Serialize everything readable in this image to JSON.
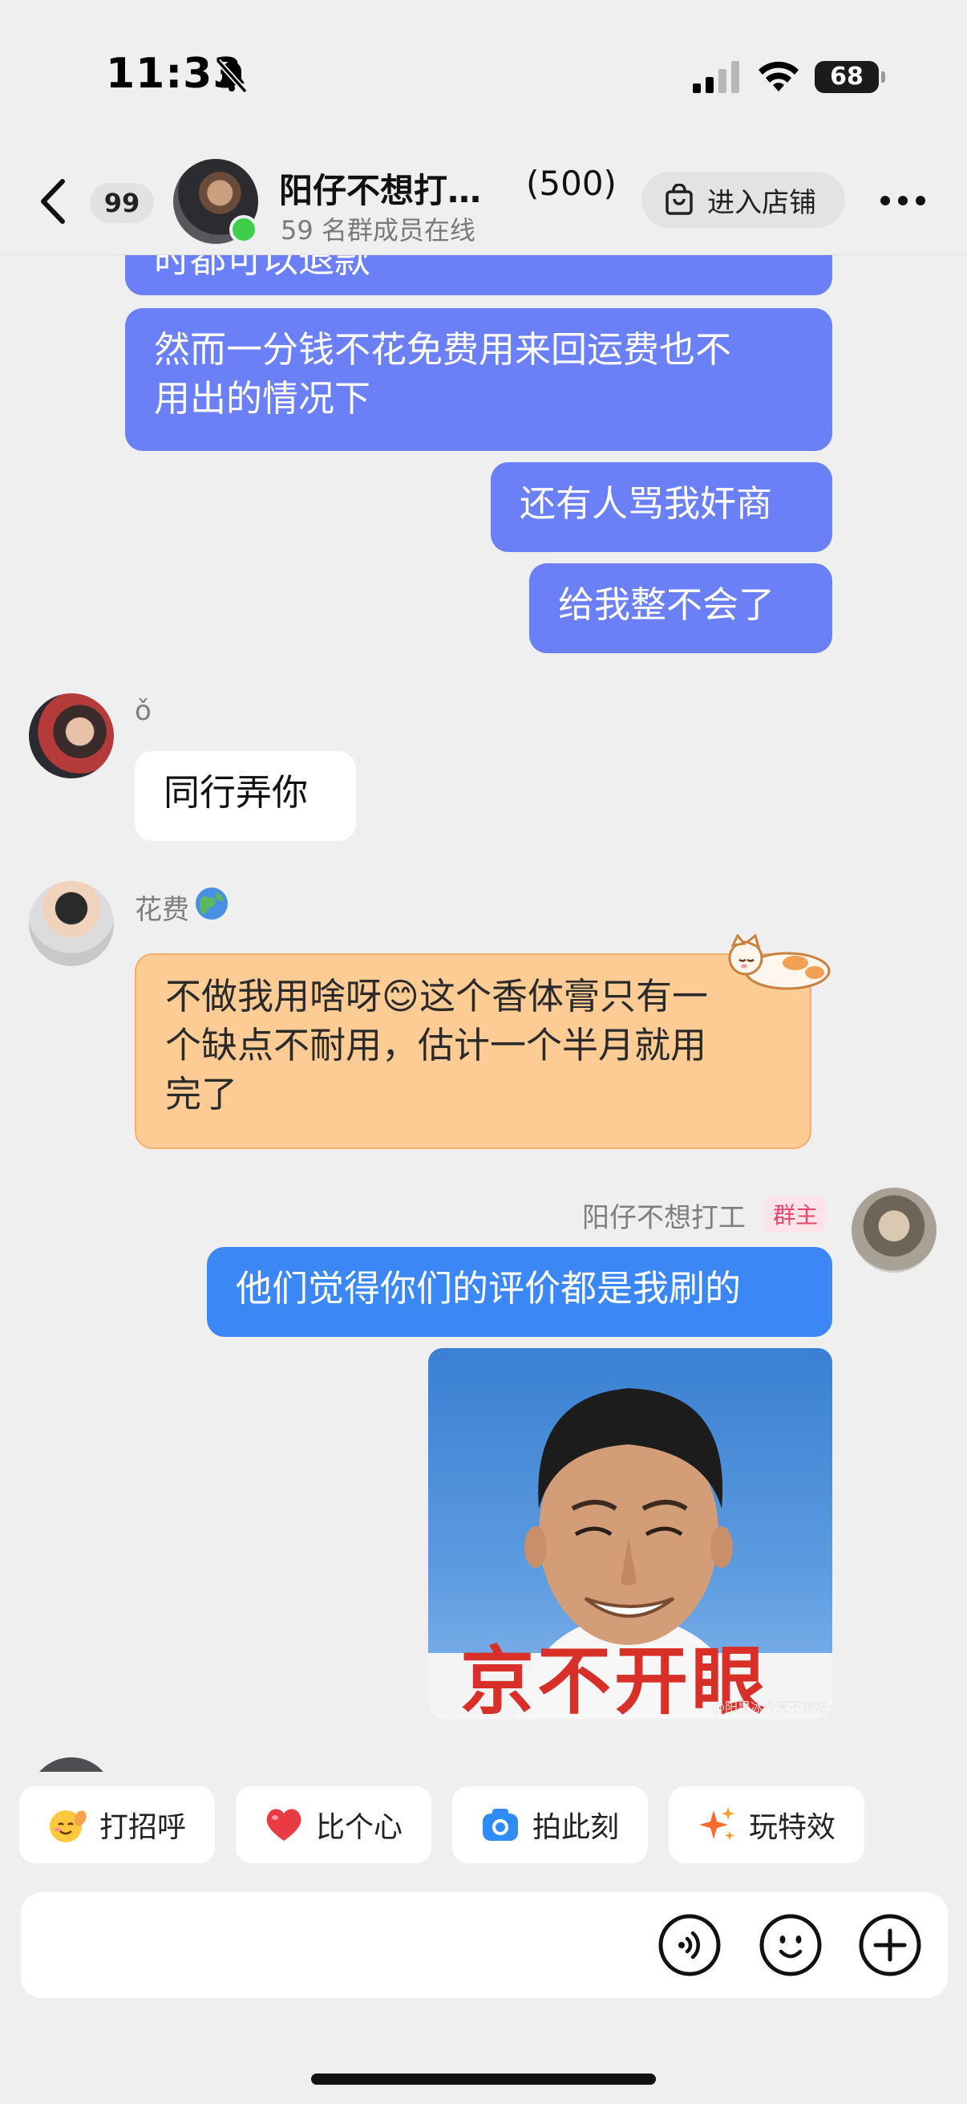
{
  "status_bar": {
    "time": "11:33",
    "battery": "68"
  },
  "header": {
    "unread_count": "99",
    "group_name": "阳仔不想打…",
    "member_count": "(500)",
    "online_text": "59 名群成员在线",
    "shop_button_label": "进入店铺"
  },
  "messages": {
    "m0_partial": "时都可以退款",
    "m1": "然而一分钱不花免费用来回运费也不\n用出的情况下",
    "m2": "还有人骂我奸商",
    "m3": "给我整不会了",
    "m4_sender": "ǒ",
    "m4": "同行弄你",
    "m5_sender": "花费",
    "m5_text": "不做我用啥呀",
    "m5_emoji": "😊",
    "m5_rest": "这个香体膏只有一\n个缺点不耐用，估计一个半月就用\n完了",
    "m6_sender": "阳仔不想打工",
    "m6_role": "群主",
    "m6": "他们觉得你们的评价都是我刷的",
    "m7_meme_caption": "京不开眼",
    "m7_meme_watermark": "@阳果冰今天不想吃"
  },
  "quick_actions": [
    {
      "label": "打招呼",
      "icon": "wave-emoji-icon"
    },
    {
      "label": "比个心",
      "icon": "heart-icon"
    },
    {
      "label": "拍此刻",
      "icon": "camera-icon"
    },
    {
      "label": "玩特效",
      "icon": "sparkle-icon"
    }
  ],
  "input": {
    "placeholder": ""
  },
  "colors": {
    "purple_bubble": "#6b7ff6",
    "blue_bubble": "#3b87f6",
    "orange_bubble": "#fdcb94",
    "online": "#3ecf4a",
    "owner_badge": "#e8456b"
  }
}
